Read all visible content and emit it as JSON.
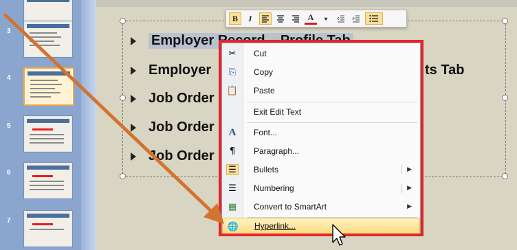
{
  "slide_panel": {
    "numbers": [
      "3",
      "4",
      "5",
      "6",
      "7"
    ]
  },
  "slide_text": {
    "bullets": [
      "Employer Record – Profile Tab",
      "Employer",
      "Job Order",
      "Job Order",
      "Job Order"
    ],
    "line2_tail": "ts Tab"
  },
  "mini_toolbar": {
    "bold_label": "B",
    "italic_label": "I",
    "font_color_label": "A"
  },
  "context_menu": {
    "items": [
      {
        "icon": "scissors-icon",
        "glyph": "✂",
        "label": "Cut"
      },
      {
        "icon": "copy-icon",
        "glyph": "⎘",
        "label": "Copy"
      },
      {
        "icon": "paste-icon",
        "glyph": "📋",
        "label": "Paste"
      },
      {
        "icon": "",
        "glyph": "",
        "label": "Exit Edit Text"
      },
      {
        "icon": "font-icon",
        "glyph": "A",
        "label": "Font..."
      },
      {
        "icon": "paragraph-icon",
        "glyph": "¶",
        "label": "Paragraph..."
      },
      {
        "icon": "bullets-icon",
        "glyph": "☰",
        "label": "Bullets"
      },
      {
        "icon": "numbering-icon",
        "glyph": "☰",
        "label": "Numbering"
      },
      {
        "icon": "smartart-icon",
        "glyph": "▦",
        "label": "Convert to SmartArt"
      },
      {
        "icon": "hyperlink-icon",
        "glyph": "🌐",
        "label": "Hyperlink..."
      }
    ]
  },
  "colors": {
    "highlight_border": "#e2242b",
    "annotation_arrow": "#d2742f",
    "hover_item": "#fddb7f"
  }
}
